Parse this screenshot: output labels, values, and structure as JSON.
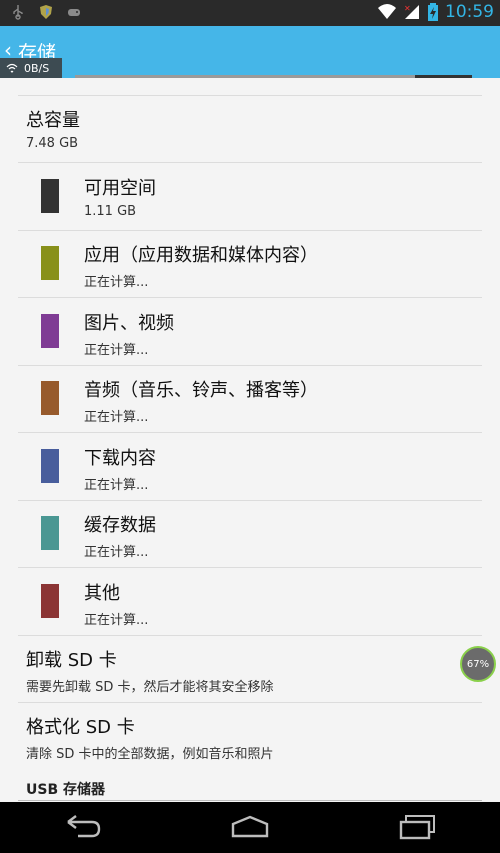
{
  "status_bar": {
    "time": "10:59",
    "icons": [
      "usb-icon",
      "shield-icon",
      "game-controller-icon",
      "wifi-icon",
      "signal-icon",
      "battery-icon"
    ]
  },
  "action_bar": {
    "title": "存储",
    "net_speed": "0B/S"
  },
  "storage": {
    "total": {
      "title": "总容量",
      "value": "7.48 GB"
    },
    "items": [
      {
        "label": "可用空间",
        "value": "1.11 GB",
        "color": "#333333"
      },
      {
        "label": "应用（应用数据和媒体内容）",
        "value": "正在计算...",
        "color": "#88901a"
      },
      {
        "label": "图片、视频",
        "value": "正在计算...",
        "color": "#7f3b94"
      },
      {
        "label": "音频（音乐、铃声、播客等）",
        "value": "正在计算...",
        "color": "#975a2c"
      },
      {
        "label": "下载内容",
        "value": "正在计算...",
        "color": "#485d9c"
      },
      {
        "label": "缓存数据",
        "value": "正在计算...",
        "color": "#4a9793"
      },
      {
        "label": "其他",
        "value": "正在计算...",
        "color": "#8b3434"
      }
    ]
  },
  "actions": {
    "unmount": {
      "title": "卸载 SD 卡",
      "desc": "需要先卸载 SD 卡，然后才能将其安全移除"
    },
    "format": {
      "title": "格式化 SD 卡",
      "desc": "清除 SD 卡中的全部数据，例如音乐和照片"
    }
  },
  "usb_section": {
    "header": "USB 存储器"
  },
  "overlay": {
    "progress": "67%"
  }
}
